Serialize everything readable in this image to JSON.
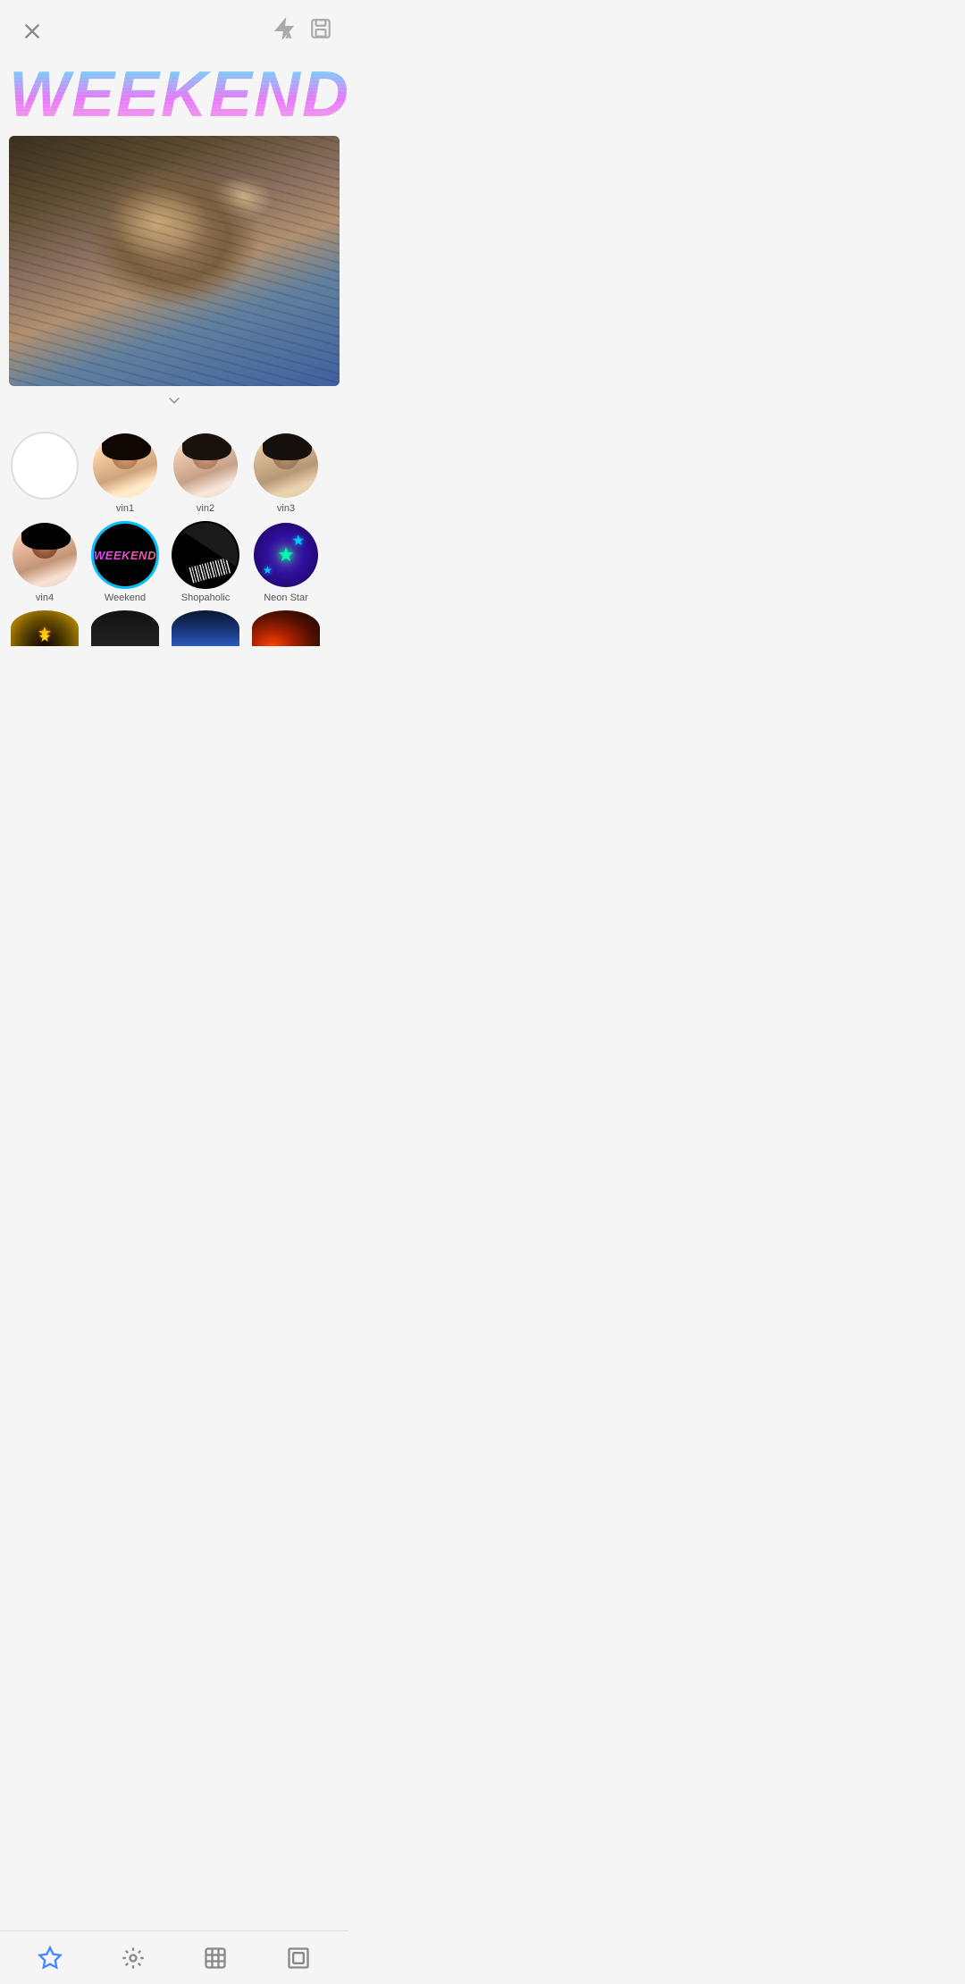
{
  "app": {
    "title": "WEEKEND"
  },
  "header": {
    "close_label": "×",
    "flash_icon": "flash-auto-icon",
    "save_icon": "save-icon"
  },
  "filters": {
    "row1": [
      {
        "id": "empty",
        "label": "",
        "type": "empty"
      },
      {
        "id": "vin1",
        "label": "vin1",
        "type": "woman"
      },
      {
        "id": "vin2",
        "label": "vin2",
        "type": "woman"
      },
      {
        "id": "vin3",
        "label": "vin3",
        "type": "woman"
      }
    ],
    "row2": [
      {
        "id": "vin4",
        "label": "vin4",
        "type": "woman4"
      },
      {
        "id": "weekend",
        "label": "Weekend",
        "type": "weekend",
        "selected": true
      },
      {
        "id": "shopaholic",
        "label": "Shopaholic",
        "type": "shopaholic"
      },
      {
        "id": "neonstar",
        "label": "Neon Star",
        "type": "neonstar"
      }
    ],
    "row3": [
      {
        "id": "r3a",
        "type": "partial-gold"
      },
      {
        "id": "r3b",
        "type": "partial-dark"
      },
      {
        "id": "r3c",
        "type": "partial-blue"
      },
      {
        "id": "r3d",
        "type": "partial-warm"
      }
    ]
  },
  "bottomNav": {
    "items": [
      {
        "id": "star",
        "label": "star",
        "icon": "star-icon",
        "active": true
      },
      {
        "id": "effects",
        "label": "effects",
        "icon": "effects-icon",
        "active": false
      },
      {
        "id": "edit",
        "label": "edit",
        "icon": "edit-icon",
        "active": false
      },
      {
        "id": "frames",
        "label": "frames",
        "icon": "frames-icon",
        "active": false
      }
    ]
  },
  "chevron": "∨",
  "neonStar": {
    "label": "Neon Star"
  }
}
